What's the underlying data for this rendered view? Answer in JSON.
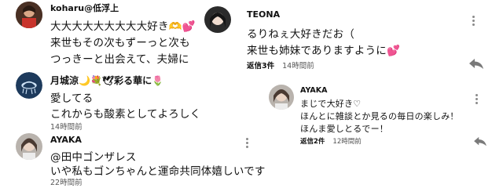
{
  "comments": [
    {
      "author": "koharu@低浮上",
      "lines": [
        "大大大大大大大大大好き🫶💕",
        "来世もその次もずーっと次も",
        "つっきーと出会えて、夫婦に"
      ]
    },
    {
      "author": "月城涼🌙💐🕊彩る華に🌷",
      "lines": [
        "愛してる",
        "これからも酸素としてよろしく"
      ],
      "time": "14時間前"
    },
    {
      "author": "AYAKA",
      "lines": [
        "@田中ゴンザレス",
        "いや私もゴンちゃんと運命共同体嬉しいです"
      ],
      "time": "22時間前"
    },
    {
      "author": "TEONA",
      "lines": [
        "るりねぇ大好きだお（",
        "来世も姉妹でありますように💕"
      ],
      "reply_count": "返信3件",
      "time": "14時間前"
    },
    {
      "author": "AYAKA",
      "lines": [
        "まじで大好き♡",
        "ほんとに雑談とか見るの毎日の楽しみ！",
        "ほんま愛しとるでー！"
      ],
      "reply_count": "返信2件",
      "time": "12時間前"
    }
  ],
  "icons": {
    "menu": "more-vert-icon",
    "reply": "reply-arrow-icon"
  },
  "colors": {
    "meta_text": "#555555",
    "icon_grey": "#8a8a8a",
    "avatar_luna_bg": "#1d3a5c",
    "avatar_luna_fg": "#cfe3f7"
  }
}
